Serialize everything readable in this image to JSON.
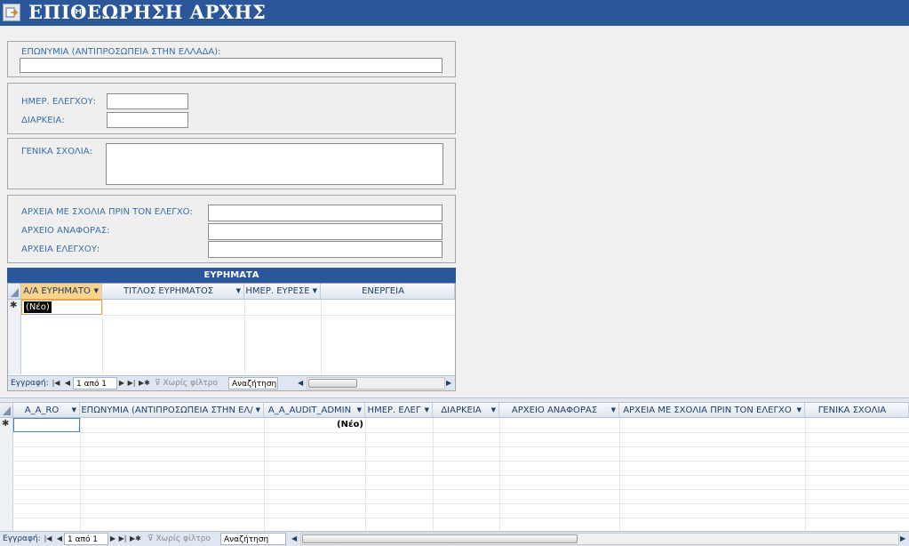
{
  "title": "ΕΠΙΘΕΩΡΗΣΗ ΑΡΧΗΣ",
  "form": {
    "eponymia_label": "ΕΠΩΝΥΜΙΑ (ΑΝΤΙΠΡΟΣΩΠΕΙΑ ΣΤΗΝ ΕΛΛΑΔΑ):",
    "eponymia_value": "",
    "hmer_elegxou_label": "ΗΜΕΡ. ΕΛΕΓΧΟΥ:",
    "hmer_elegxou_value": "",
    "diarkeia_label": "ΔΙΑΡΚΕΙΑ:",
    "diarkeia_value": "",
    "genika_sxolia_label": "ΓΕΝΙΚΑ ΣΧΟΛΙΑ:",
    "genika_sxolia_value": "",
    "arxeia_sxolia_label": "ΑΡΧΕΙΑ ΜΕ ΣΧΟΛΙΑ ΠΡΙΝ ΤΟΝ ΕΛΕΓΧΟ:",
    "arxeio_anaforas_label": "ΑΡΧΕΙΟ ΑΝΑΦΟΡΑΣ:",
    "arxeia_elegxou_label": "ΑΡΧΕΙΑ ΕΛΕΓΧΟΥ:"
  },
  "findings": {
    "header": "ΕΥΡΗΜΑΤΑ",
    "columns": [
      "Α/Α ΕΥΡΗΜΑΤΟ",
      "ΤΙΤΛΟΣ ΕΥΡΗΜΑΤΟΣ",
      "ΗΜΕΡ. ΕΥΡΕΣΕ",
      "ΕΝΕΡΓΕΙΑ"
    ],
    "new_record": "(Νέο)",
    "new_marker": "✱",
    "nav": {
      "label": "Εγγραφή:",
      "position": "1 από 1",
      "no_filter": "Χωρίς φίλτρο",
      "search": "Αναζήτηση"
    }
  },
  "datasheet": {
    "columns": [
      "A_A_RO",
      "ΕΠΩΝΥΜΙΑ (ΑΝΤΙΠΡΟΣΩΠΕΙΑ ΣΤΗΝ ΕΛ/",
      "A_A_AUDIT_ADMIN",
      "ΗΜΕΡ. ΕΛΕΓ",
      "ΔΙΑΡΚΕΙΑ",
      "ΑΡΧΕΙΟ ΑΝΑΦΟΡΑΣ",
      "ΑΡΧΕΙΑ ΜΕ ΣΧΟΛΙΑ ΠΡΙΝ ΤΟΝ ΕΛΕΓΧΟ",
      "ΓΕΝΙΚΑ ΣΧΟΛΙΑ"
    ],
    "new_record": "(Νέο)",
    "new_marker": "✱",
    "nav": {
      "label": "Εγγραφή:",
      "position": "1 από 1",
      "no_filter": "Χωρίς φίλτρο",
      "search": "Αναζήτηση"
    }
  },
  "colors": {
    "brand": "#2b579a",
    "selected_header": "#fbd38a",
    "label": "#3a6ea5"
  }
}
